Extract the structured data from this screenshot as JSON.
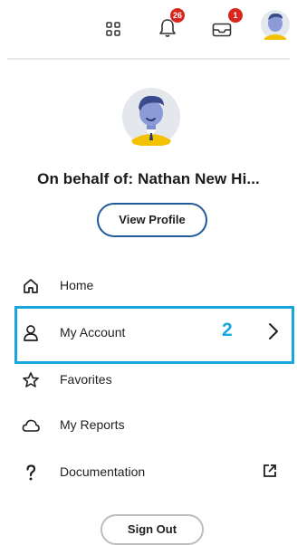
{
  "topbar": {
    "apps_icon": "apps-grid-icon",
    "notifications": {
      "icon": "bell-icon",
      "badge": "26"
    },
    "inbox": {
      "icon": "inbox-icon",
      "badge": "1"
    },
    "avatar_icon": "user-avatar-icon"
  },
  "profile": {
    "avatar_icon": "user-avatar-icon",
    "behalf_text": "On behalf of: Nathan New Hi...",
    "view_profile_label": "View Profile"
  },
  "menu": {
    "items": [
      {
        "label": "Home",
        "icon": "home-icon"
      },
      {
        "label": "My Account",
        "icon": "person-icon",
        "trailing_icon": "chevron-right-icon"
      },
      {
        "label": "Favorites",
        "icon": "star-icon"
      },
      {
        "label": "My Reports",
        "icon": "cloud-icon"
      },
      {
        "label": "Documentation",
        "icon": "question-icon",
        "trailing_icon": "external-link-icon"
      }
    ]
  },
  "annotation": {
    "step_number": "2",
    "color": "#1aa6dc"
  },
  "sign_out_label": "Sign Out",
  "colors": {
    "accent_border": "#1f5c99",
    "badge": "#d6261e",
    "highlight": "#1aa6dc"
  }
}
